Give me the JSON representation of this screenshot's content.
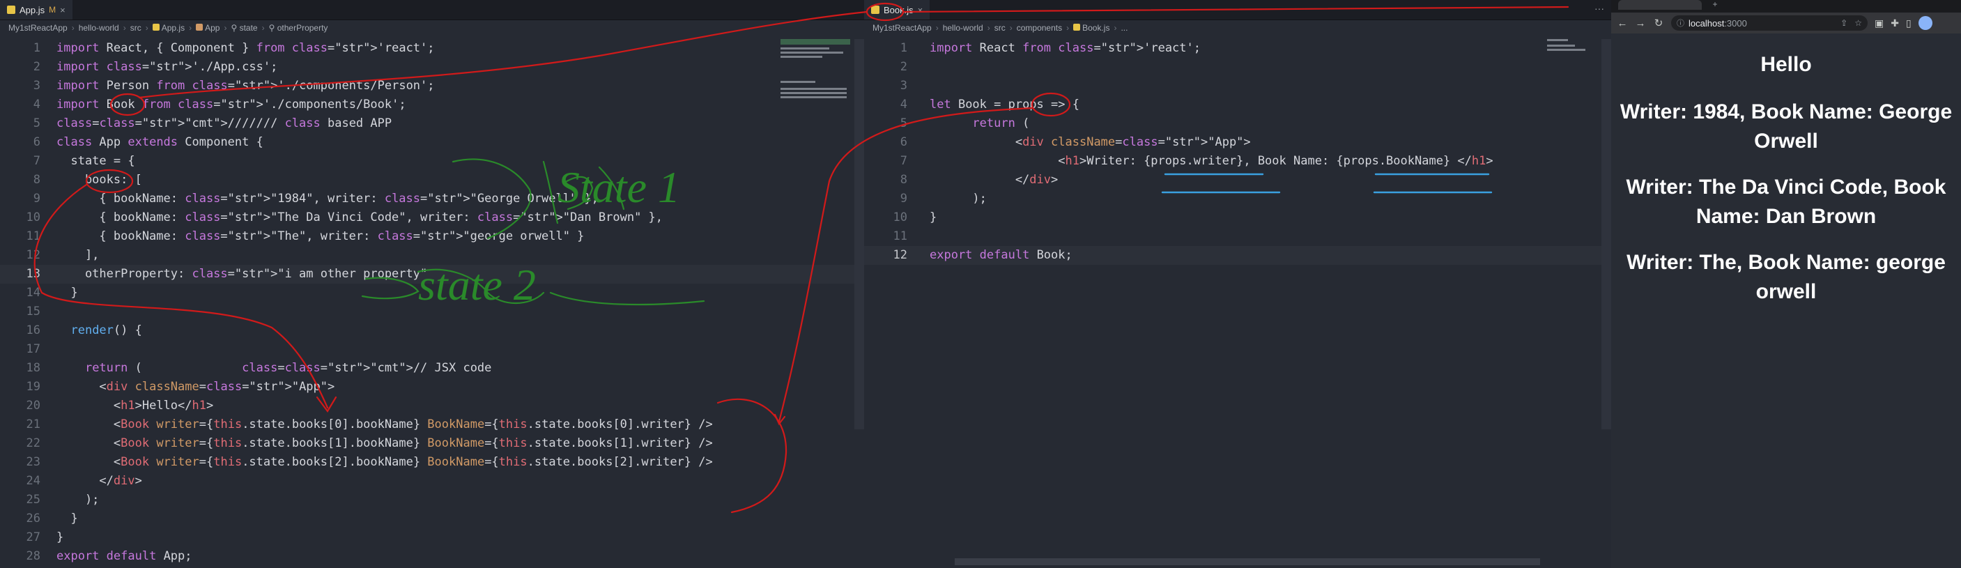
{
  "left_editor": {
    "tab": {
      "file": "App.js",
      "modified": "M",
      "close": "×"
    },
    "breadcrumb": [
      "My1stReactApp",
      "hello-world",
      "src",
      "App.js",
      "App",
      "state",
      "otherProperty"
    ],
    "lines": [
      {
        "n": "1"
      },
      {
        "n": "2"
      },
      {
        "n": "3"
      },
      {
        "n": "4"
      },
      {
        "n": "5"
      },
      {
        "n": "6"
      },
      {
        "n": "7"
      },
      {
        "n": "8"
      },
      {
        "n": "9"
      },
      {
        "n": "10"
      },
      {
        "n": "11"
      },
      {
        "n": "12"
      },
      {
        "n": "13"
      },
      {
        "n": "14"
      },
      {
        "n": "15"
      },
      {
        "n": "16"
      },
      {
        "n": "17"
      },
      {
        "n": "18"
      },
      {
        "n": "19"
      },
      {
        "n": "20"
      },
      {
        "n": "21"
      },
      {
        "n": "22"
      },
      {
        "n": "23"
      },
      {
        "n": "24"
      },
      {
        "n": "25"
      },
      {
        "n": "26"
      },
      {
        "n": "27"
      },
      {
        "n": "28"
      }
    ],
    "code": [
      "import React, { Component } from 'react';",
      "import './App.css';",
      "import Person from './components/Person';",
      "import Book from './components/Book';",
      "/////// class based APP",
      "class App extends Component {",
      "  state = {",
      "    books: [",
      "      { bookName: \"1984\", writer: \"George Orwell\" },",
      "      { bookName: \"The Da Vinci Code\", writer: \"Dan Brown\" },",
      "      { bookName: \"The\", writer: \"george orwell\" }",
      "    ],",
      "    otherProperty: \"i am other property\"",
      "  }",
      "",
      "  render() {",
      "",
      "    return (              // JSX code",
      "      <div className=\"App\">",
      "        <h1>Hello</h1>",
      "        <Book writer={this.state.books[0].bookName} BookName={this.state.books[0].writer} />",
      "        <Book writer={this.state.books[1].bookName} BookName={this.state.books[1].writer} />",
      "        <Book writer={this.state.books[2].bookName} BookName={this.state.books[2].writer} />",
      "      </div>",
      "    );",
      "  }",
      "}",
      "export default App;"
    ],
    "active_line": 13
  },
  "right_editor": {
    "tab": {
      "file": "Book.js",
      "close": "×"
    },
    "menu": "···",
    "breadcrumb": [
      "My1stReactApp",
      "hello-world",
      "src",
      "components",
      "Book.js",
      "..."
    ],
    "lines": [
      {
        "n": "1"
      },
      {
        "n": "2"
      },
      {
        "n": "3"
      },
      {
        "n": "4"
      },
      {
        "n": "5"
      },
      {
        "n": "6"
      },
      {
        "n": "7"
      },
      {
        "n": "8"
      },
      {
        "n": "9"
      },
      {
        "n": "10"
      },
      {
        "n": "11"
      },
      {
        "n": "12"
      }
    ],
    "code": [
      "import React from 'react';",
      "",
      "",
      "let Book = props => {",
      "      return (",
      "            <div className=\"App\">",
      "                  <h1>Writer: {props.writer}, Book Name: {props.BookName} </h1>",
      "            </div>",
      "      );",
      "}",
      "",
      "export default Book;"
    ],
    "active_line": 12
  },
  "browser": {
    "url_host": "localhost",
    "url_port": ":3000",
    "new_tab": "+",
    "headings": [
      "Hello",
      "Writer: 1984, Book Name: George Orwell",
      "Writer: The Da Vinci Code, Book Name: Dan Brown",
      "Writer: The, Book Name: george orwell"
    ]
  },
  "annotations": {
    "state1": "State 1",
    "state2": "state 2"
  },
  "colors": {
    "keyword": "#c678dd",
    "string": "#98c379",
    "tag": "#e06c75",
    "attribute": "#d19a66",
    "comment": "#6a7381",
    "annotation_red": "#d11a1a",
    "annotation_green": "#2a8a2a",
    "annotation_blue": "#3aa0e0"
  }
}
